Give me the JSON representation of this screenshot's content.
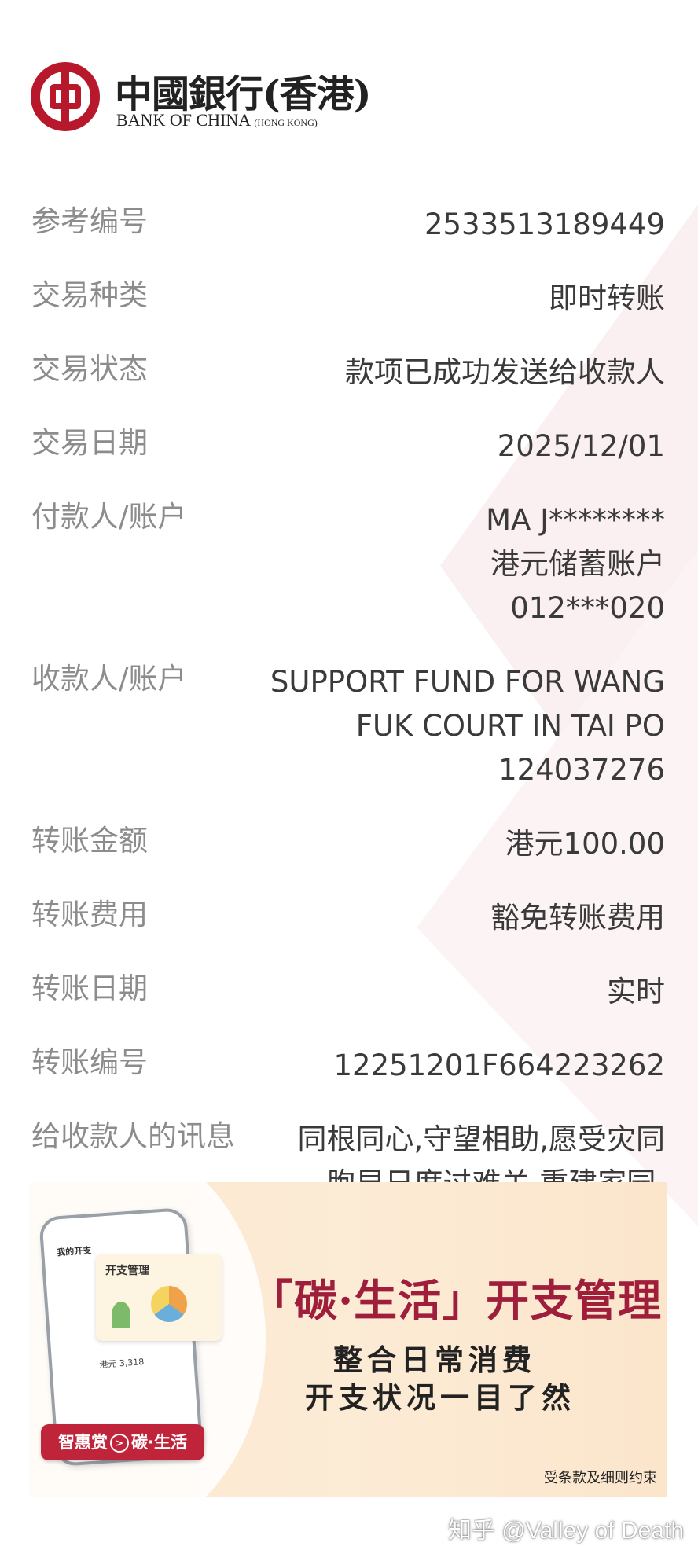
{
  "bank": {
    "name_cn": "中國銀行(香港)",
    "name_en": "BANK OF CHINA",
    "name_en_sub": "(HONG KONG)"
  },
  "details": [
    {
      "label": "参考编号",
      "values": [
        "2533513189449"
      ]
    },
    {
      "label": "交易种类",
      "values": [
        "即时转账"
      ]
    },
    {
      "label": "交易状态",
      "values": [
        "款项已成功发送给收款人"
      ]
    },
    {
      "label": "交易日期",
      "values": [
        "2025/12/01"
      ]
    },
    {
      "label": "付款人/账户",
      "values": [
        "MA J********",
        "港元储蓄账户",
        "012***020"
      ]
    },
    {
      "label": "收款人/账户",
      "values": [
        "SUPPORT FUND FOR WANG",
        "FUK COURT IN TAI PO",
        "124037276"
      ]
    },
    {
      "label": "转账金额",
      "values": [
        "港元100.00"
      ]
    },
    {
      "label": "转账费用",
      "values": [
        "豁免转账费用"
      ]
    },
    {
      "label": "转账日期",
      "values": [
        "实时"
      ]
    },
    {
      "label": "转账编号",
      "values": [
        "12251201F664223262"
      ]
    },
    {
      "label": "给收款人的讯息",
      "values": [
        "同根同心,守望相助,愿受灾同",
        "胞早日度过难关,重建家园."
      ]
    }
  ],
  "banner": {
    "heading": "「碳·生活」开支管理",
    "line1": "整合日常消费",
    "line2": "开支状况一目了然",
    "terms": "受条款及细则约束",
    "cta_left": "智惠赏",
    "cta_arrow": ">",
    "cta_right": "碳·生活",
    "phone_title": "我的开支",
    "phone_amount": "港元 3,318",
    "card_title": "开支管理"
  },
  "watermark": "知乎 @Valley of Death",
  "colors": {
    "brand_red": "#b8182b",
    "banner_heading": "#9e1e3c",
    "label_gray": "#8c8c8c"
  }
}
